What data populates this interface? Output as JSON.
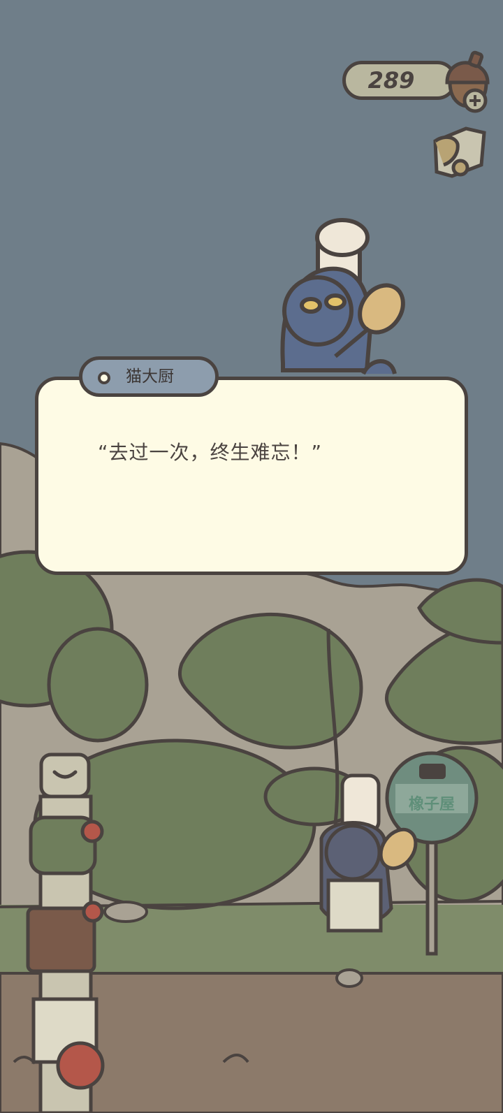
{
  "hud": {
    "acorn_count": "289",
    "acorn_icon": "acorn-icon",
    "plus_icon": "plus-icon",
    "map_icon": "map-icon"
  },
  "dialog": {
    "speaker": "猫大厨",
    "text": "“去过一次，终生难忘！”"
  },
  "scene": {
    "bus_stop_sign": "橡子屋",
    "bus_icon": "bus-icon",
    "dropdown_icon": "chevron-down-icon",
    "items": [
      "backpack-icon",
      "book-icon",
      "map-paper-icon",
      "apple-icon"
    ]
  },
  "colors": {
    "sky": "#6f7e89",
    "mountain": "#a9a294",
    "leaf": "#6f7e5c",
    "ground": "#8c7a6a",
    "dialog_bg": "#fefbe5",
    "outline": "#4a4340",
    "name_tag": "#8d9dad"
  }
}
